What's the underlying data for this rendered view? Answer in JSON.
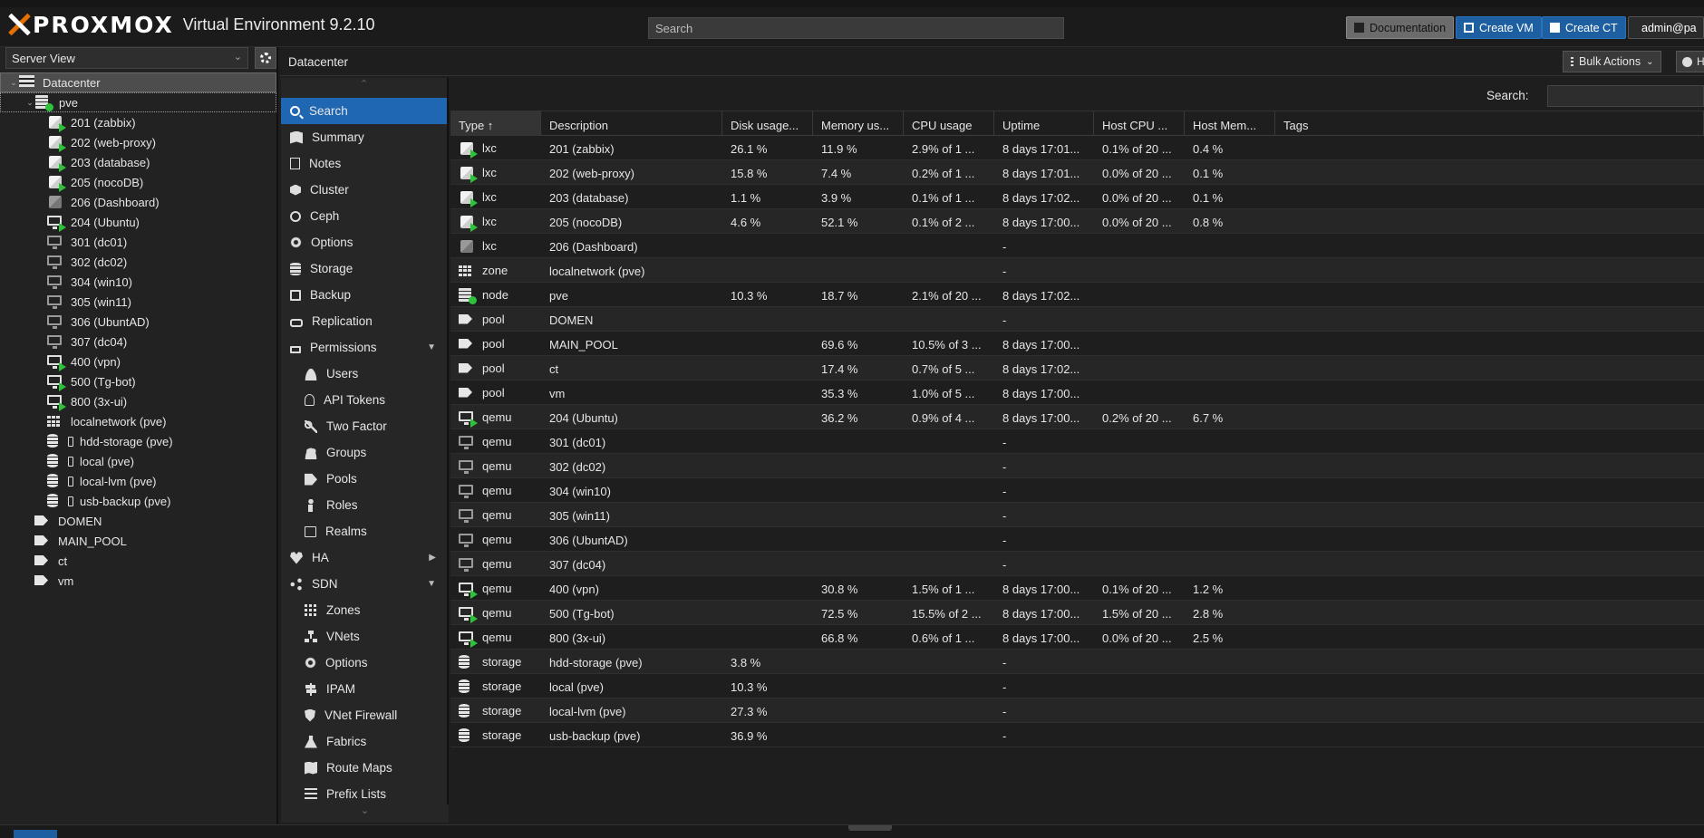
{
  "app": {
    "brand": "PROXMOX",
    "subtitle": "Virtual Environment 9.2.10",
    "search_placeholder": "Search",
    "buttons": {
      "documentation": "Documentation",
      "create_vm": "Create VM",
      "create_ct": "Create CT",
      "user": "admin@pa"
    },
    "accent_color": "#2067b3",
    "running_color": "#2ec23a"
  },
  "tree": {
    "view_selector": "Server View",
    "items": [
      {
        "label": "Datacenter",
        "icon": "datacenter-icon",
        "depth": 0,
        "expanded": true,
        "selected": true
      },
      {
        "label": "pve",
        "icon": "node-online-icon",
        "depth": 1,
        "expanded": true
      },
      {
        "label": "201 (zabbix)",
        "icon": "ct-running-icon",
        "depth": 2
      },
      {
        "label": "202 (web-proxy)",
        "icon": "ct-running-icon",
        "depth": 2
      },
      {
        "label": "203 (database)",
        "icon": "ct-running-icon",
        "depth": 2
      },
      {
        "label": "205 (nocoDB)",
        "icon": "ct-running-icon",
        "depth": 2
      },
      {
        "label": "206 (Dashboard)",
        "icon": "ct-stopped-icon",
        "depth": 2
      },
      {
        "label": "204 (Ubuntu)",
        "icon": "vm-running-icon",
        "depth": 2
      },
      {
        "label": "301 (dc01)",
        "icon": "vm-stopped-icon",
        "depth": 2
      },
      {
        "label": "302 (dc02)",
        "icon": "vm-stopped-icon",
        "depth": 2
      },
      {
        "label": "304 (win10)",
        "icon": "vm-stopped-icon",
        "depth": 2
      },
      {
        "label": "305 (win11)",
        "icon": "vm-stopped-icon",
        "depth": 2
      },
      {
        "label": "306 (UbuntAD)",
        "icon": "vm-stopped-icon",
        "depth": 2
      },
      {
        "label": "307 (dc04)",
        "icon": "vm-stopped-icon",
        "depth": 2
      },
      {
        "label": "400 (vpn)",
        "icon": "vm-running-icon",
        "depth": 2
      },
      {
        "label": "500 (Tg-bot)",
        "icon": "vm-running-icon",
        "depth": 2
      },
      {
        "label": "800 (3x-ui)",
        "icon": "vm-running-icon",
        "depth": 2
      },
      {
        "label": "localnetwork (pve)",
        "icon": "zone-icon",
        "depth": 2
      },
      {
        "label": "hdd-storage (pve)",
        "icon": "storage-icon",
        "depth": 2
      },
      {
        "label": "local (pve)",
        "icon": "storage-icon",
        "depth": 2
      },
      {
        "label": "local-lvm (pve)",
        "icon": "storage-icon",
        "depth": 2
      },
      {
        "label": "usb-backup (pve)",
        "icon": "storage-icon",
        "depth": 2
      },
      {
        "label": "DOMEN",
        "icon": "pool-icon",
        "depth": 1
      },
      {
        "label": "MAIN_POOL",
        "icon": "pool-icon",
        "depth": 1
      },
      {
        "label": "ct",
        "icon": "pool-icon",
        "depth": 1
      },
      {
        "label": "vm",
        "icon": "pool-icon",
        "depth": 1
      }
    ]
  },
  "content": {
    "title": "Datacenter",
    "bulk_actions": "Bulk Actions",
    "help": "H"
  },
  "nav": [
    {
      "label": "Search",
      "icon": "search-icon",
      "active": true
    },
    {
      "label": "Summary",
      "icon": "book-icon"
    },
    {
      "label": "Notes",
      "icon": "notes-icon"
    },
    {
      "label": "Cluster",
      "icon": "cluster-icon"
    },
    {
      "label": "Ceph",
      "icon": "ceph-icon"
    },
    {
      "label": "Options",
      "icon": "gear-icon"
    },
    {
      "label": "Storage",
      "icon": "database-icon"
    },
    {
      "label": "Backup",
      "icon": "floppy-icon"
    },
    {
      "label": "Replication",
      "icon": "replication-icon"
    },
    {
      "label": "Permissions",
      "icon": "unlock-icon",
      "arrow": "down"
    },
    {
      "label": "Users",
      "icon": "user-icon",
      "sub": true
    },
    {
      "label": "API Tokens",
      "icon": "user-outline-icon",
      "sub": true
    },
    {
      "label": "Two Factor",
      "icon": "key-icon",
      "sub": true
    },
    {
      "label": "Groups",
      "icon": "users-icon",
      "sub": true
    },
    {
      "label": "Pools",
      "icon": "tags-icon",
      "sub": true
    },
    {
      "label": "Roles",
      "icon": "male-icon",
      "sub": true
    },
    {
      "label": "Realms",
      "icon": "realm-icon",
      "sub": true
    },
    {
      "label": "HA",
      "icon": "heartbeat-icon",
      "arrow": "right"
    },
    {
      "label": "SDN",
      "icon": "sdn-icon",
      "arrow": "down"
    },
    {
      "label": "Zones",
      "icon": "zones-icon",
      "sub": true
    },
    {
      "label": "VNets",
      "icon": "sitemap-icon",
      "sub": true
    },
    {
      "label": "Options",
      "icon": "gear-icon",
      "sub": true
    },
    {
      "label": "IPAM",
      "icon": "signpost-icon",
      "sub": true
    },
    {
      "label": "VNet Firewall",
      "icon": "shield-icon",
      "sub": true
    },
    {
      "label": "Fabrics",
      "icon": "flask-icon",
      "sub": true
    },
    {
      "label": "Route Maps",
      "icon": "map-icon",
      "sub": true
    },
    {
      "label": "Prefix Lists",
      "icon": "list-icon",
      "sub": true
    }
  ],
  "grid": {
    "search_label": "Search:",
    "columns": [
      "Type ↑",
      "Description",
      "Disk usage...",
      "Memory us...",
      "CPU usage",
      "Uptime",
      "Host CPU ...",
      "Host Mem...",
      "Tags"
    ],
    "rows": [
      {
        "icon": "ct-running-icon",
        "type": "lxc",
        "desc": "201 (zabbix)",
        "disk": "26.1 %",
        "mem": "11.9 %",
        "cpu": "2.9% of 1 ...",
        "uptime": "8 days 17:01...",
        "hcpu": "0.1% of 20 ...",
        "hmem": "0.4 %",
        "tags": ""
      },
      {
        "icon": "ct-running-icon",
        "type": "lxc",
        "desc": "202 (web-proxy)",
        "disk": "15.8 %",
        "mem": "7.4 %",
        "cpu": "0.2% of 1 ...",
        "uptime": "8 days 17:01...",
        "hcpu": "0.0% of 20 ...",
        "hmem": "0.1 %",
        "tags": ""
      },
      {
        "icon": "ct-running-icon",
        "type": "lxc",
        "desc": "203 (database)",
        "disk": "1.1 %",
        "mem": "3.9 %",
        "cpu": "0.1% of 1 ...",
        "uptime": "8 days 17:02...",
        "hcpu": "0.0% of 20 ...",
        "hmem": "0.1 %",
        "tags": ""
      },
      {
        "icon": "ct-running-icon",
        "type": "lxc",
        "desc": "205 (nocoDB)",
        "disk": "4.6 %",
        "mem": "52.1 %",
        "cpu": "0.1% of 2 ...",
        "uptime": "8 days 17:00...",
        "hcpu": "0.0% of 20 ...",
        "hmem": "0.8 %",
        "tags": ""
      },
      {
        "icon": "ct-stopped-icon",
        "type": "lxc",
        "desc": "206 (Dashboard)",
        "disk": "",
        "mem": "",
        "cpu": "",
        "uptime": "-",
        "hcpu": "",
        "hmem": "",
        "tags": ""
      },
      {
        "icon": "zone-icon",
        "type": "zone",
        "desc": "localnetwork (pve)",
        "disk": "",
        "mem": "",
        "cpu": "",
        "uptime": "-",
        "hcpu": "",
        "hmem": "",
        "tags": ""
      },
      {
        "icon": "node-online-icon",
        "type": "node",
        "desc": "pve",
        "disk": "10.3 %",
        "mem": "18.7 %",
        "cpu": "2.1% of 20 ...",
        "uptime": "8 days 17:02...",
        "hcpu": "",
        "hmem": "",
        "tags": ""
      },
      {
        "icon": "pool-icon",
        "type": "pool",
        "desc": "DOMEN",
        "disk": "",
        "mem": "",
        "cpu": "",
        "uptime": "-",
        "hcpu": "",
        "hmem": "",
        "tags": ""
      },
      {
        "icon": "pool-icon",
        "type": "pool",
        "desc": "MAIN_POOL",
        "disk": "",
        "mem": "69.6 %",
        "cpu": "10.5% of 3 ...",
        "uptime": "8 days 17:00...",
        "hcpu": "",
        "hmem": "",
        "tags": ""
      },
      {
        "icon": "pool-icon",
        "type": "pool",
        "desc": "ct",
        "disk": "",
        "mem": "17.4 %",
        "cpu": "0.7% of 5 ...",
        "uptime": "8 days 17:02...",
        "hcpu": "",
        "hmem": "",
        "tags": ""
      },
      {
        "icon": "pool-icon",
        "type": "pool",
        "desc": "vm",
        "disk": "",
        "mem": "35.3 %",
        "cpu": "1.0% of 5 ...",
        "uptime": "8 days 17:00...",
        "hcpu": "",
        "hmem": "",
        "tags": ""
      },
      {
        "icon": "vm-running-icon",
        "type": "qemu",
        "desc": "204 (Ubuntu)",
        "disk": "",
        "mem": "36.2 %",
        "cpu": "0.9% of 4 ...",
        "uptime": "8 days 17:00...",
        "hcpu": "0.2% of 20 ...",
        "hmem": "6.7 %",
        "tags": ""
      },
      {
        "icon": "vm-stopped-icon",
        "type": "qemu",
        "desc": "301 (dc01)",
        "disk": "",
        "mem": "",
        "cpu": "",
        "uptime": "-",
        "hcpu": "",
        "hmem": "",
        "tags": ""
      },
      {
        "icon": "vm-stopped-icon",
        "type": "qemu",
        "desc": "302 (dc02)",
        "disk": "",
        "mem": "",
        "cpu": "",
        "uptime": "-",
        "hcpu": "",
        "hmem": "",
        "tags": ""
      },
      {
        "icon": "vm-stopped-icon",
        "type": "qemu",
        "desc": "304 (win10)",
        "disk": "",
        "mem": "",
        "cpu": "",
        "uptime": "-",
        "hcpu": "",
        "hmem": "",
        "tags": ""
      },
      {
        "icon": "vm-stopped-icon",
        "type": "qemu",
        "desc": "305 (win11)",
        "disk": "",
        "mem": "",
        "cpu": "",
        "uptime": "-",
        "hcpu": "",
        "hmem": "",
        "tags": ""
      },
      {
        "icon": "vm-stopped-icon",
        "type": "qemu",
        "desc": "306 (UbuntAD)",
        "disk": "",
        "mem": "",
        "cpu": "",
        "uptime": "-",
        "hcpu": "",
        "hmem": "",
        "tags": ""
      },
      {
        "icon": "vm-stopped-icon",
        "type": "qemu",
        "desc": "307 (dc04)",
        "disk": "",
        "mem": "",
        "cpu": "",
        "uptime": "-",
        "hcpu": "",
        "hmem": "",
        "tags": ""
      },
      {
        "icon": "vm-running-icon",
        "type": "qemu",
        "desc": "400 (vpn)",
        "disk": "",
        "mem": "30.8 %",
        "cpu": "1.5% of 1 ...",
        "uptime": "8 days 17:00...",
        "hcpu": "0.1% of 20 ...",
        "hmem": "1.2 %",
        "tags": ""
      },
      {
        "icon": "vm-running-icon",
        "type": "qemu",
        "desc": "500 (Tg-bot)",
        "disk": "",
        "mem": "72.5 %",
        "cpu": "15.5% of 2 ...",
        "uptime": "8 days 17:00...",
        "hcpu": "1.5% of 20 ...",
        "hmem": "2.8 %",
        "tags": ""
      },
      {
        "icon": "vm-running-icon",
        "type": "qemu",
        "desc": "800 (3x-ui)",
        "disk": "",
        "mem": "66.8 %",
        "cpu": "0.6% of 1 ...",
        "uptime": "8 days 17:00...",
        "hcpu": "0.0% of 20 ...",
        "hmem": "2.5 %",
        "tags": ""
      },
      {
        "icon": "storage-icon",
        "type": "storage",
        "desc": "hdd-storage (pve)",
        "disk": "3.8 %",
        "mem": "",
        "cpu": "",
        "uptime": "-",
        "hcpu": "",
        "hmem": "",
        "tags": ""
      },
      {
        "icon": "storage-icon",
        "type": "storage",
        "desc": "local (pve)",
        "disk": "10.3 %",
        "mem": "",
        "cpu": "",
        "uptime": "-",
        "hcpu": "",
        "hmem": "",
        "tags": ""
      },
      {
        "icon": "storage-icon",
        "type": "storage",
        "desc": "local-lvm (pve)",
        "disk": "27.3 %",
        "mem": "",
        "cpu": "",
        "uptime": "-",
        "hcpu": "",
        "hmem": "",
        "tags": ""
      },
      {
        "icon": "storage-icon",
        "type": "storage",
        "desc": "usb-backup (pve)",
        "disk": "36.9 %",
        "mem": "",
        "cpu": "",
        "uptime": "-",
        "hcpu": "",
        "hmem": "",
        "tags": ""
      }
    ]
  }
}
